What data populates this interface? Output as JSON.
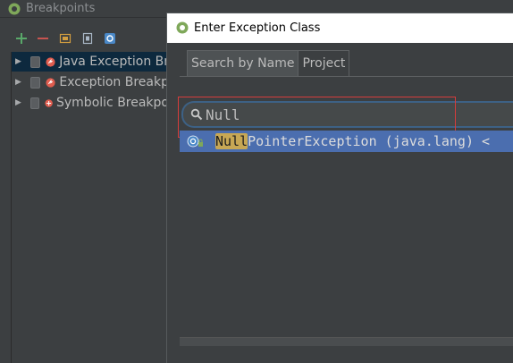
{
  "breakpoints_window": {
    "title": "Breakpoints",
    "toolbar": {
      "add_label": "Add",
      "remove_label": "Remove"
    },
    "tree": [
      {
        "label": "Java Exception Br",
        "selected": true,
        "icon": "exception-breakpoint-icon"
      },
      {
        "label": "Exception Breakp",
        "selected": false,
        "icon": "exception-breakpoint-icon"
      },
      {
        "label": "Symbolic Breakpo",
        "selected": false,
        "icon": "symbolic-breakpoint-icon"
      }
    ]
  },
  "dialog": {
    "title": "Enter Exception Class",
    "tabs": [
      {
        "label": "Search by Name",
        "active": true
      },
      {
        "label": "Project",
        "active": false
      }
    ],
    "search": {
      "value": "Null",
      "placeholder": ""
    },
    "results": [
      {
        "match": "Null",
        "rest": "PointerException",
        "package": " (java.lang) <"
      }
    ]
  },
  "colors": {
    "background": "#3c3f41",
    "selection": "#4b6eaf",
    "tree_selection": "#0d293e",
    "match_highlight": "#c7a754",
    "annotation_red": "#d63c3c",
    "add_green": "#59a869",
    "remove_red": "#c75450"
  }
}
